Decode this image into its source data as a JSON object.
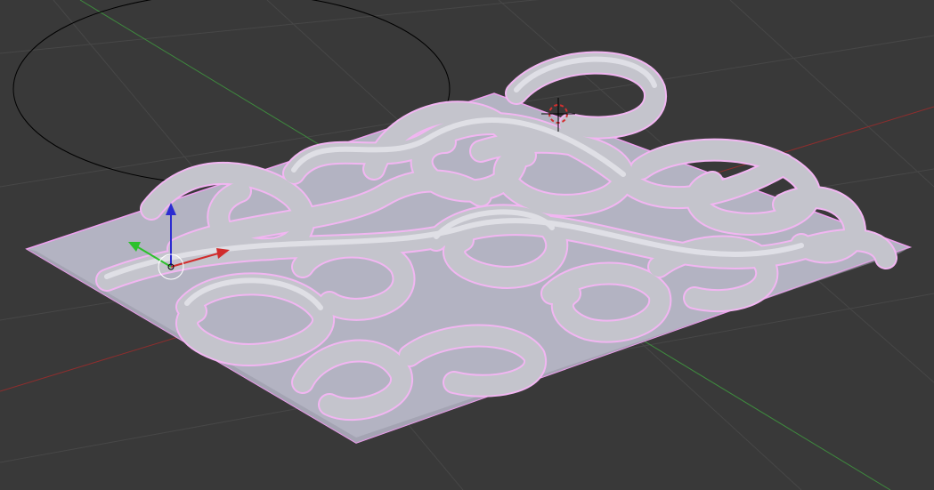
{
  "viewport": {
    "background": "#393939",
    "grid_color": "#4a4a4a",
    "x_axis_color": "#8e2e2e",
    "y_axis_color": "#3e8a3e",
    "plane_color": "#b3b3c2",
    "plane_selected_outline": "#f0a0f0",
    "tube_color": "#c4c4cc",
    "tube_outline": "#f2b6f2"
  },
  "objects": {
    "plane": {
      "name_icon": "mesh-plane-icon"
    },
    "curve": {
      "name_icon": "curve-tube-icon"
    },
    "camera_circle": {
      "name_icon": "circle-icon"
    }
  },
  "gizmo": {
    "x_color": "#d12c2c",
    "y_color": "#2cc12c",
    "z_color": "#2c2cd1"
  },
  "cursor": {
    "icon": "3d-cursor-icon"
  }
}
